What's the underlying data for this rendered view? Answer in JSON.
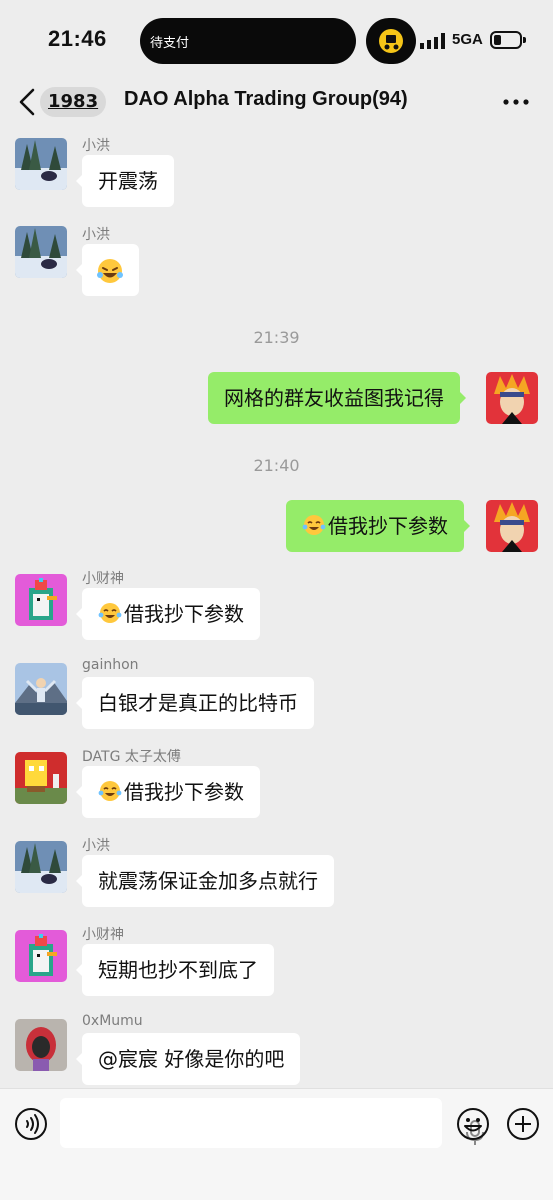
{
  "status_bar": {
    "time": "21:46",
    "island_text": "待支付",
    "network": "5GA",
    "battery_level": 0.3
  },
  "nav": {
    "unread_count": "1983",
    "title": "DAO Alpha Trading Group(94)"
  },
  "messages": [
    {
      "sender": "小洪",
      "text": "开震荡",
      "avatar": "snow-forest-avatar"
    },
    {
      "sender": "小洪",
      "text": "",
      "emoji": "laughing-emoji",
      "avatar": "snow-forest-avatar"
    },
    {
      "time": "21:39"
    },
    {
      "self": true,
      "text": "网格的群友收益图我记得",
      "avatar": "naruto-avatar"
    },
    {
      "time": "21:40"
    },
    {
      "self": true,
      "text": "借我抄下参数",
      "emoji": "tears-of-joy-emoji",
      "avatar": "naruto-avatar"
    },
    {
      "sender": "小财神",
      "text": "借我抄下参数",
      "emoji": "tears-of-joy-emoji",
      "avatar": "pixel-penguin-avatar"
    },
    {
      "sender": "gainhon",
      "text": "白银才是真正的比特币",
      "avatar": "mountain-person-avatar"
    },
    {
      "sender": "DATG 太子太傅",
      "text": "借我抄下参数",
      "emoji": "tears-of-joy-emoji",
      "avatar": "sponge-figure-avatar"
    },
    {
      "sender": "小洪",
      "text": "就震荡保证金加多点就行",
      "avatar": "snow-forest-avatar"
    },
    {
      "sender": "小财神",
      "text": "短期也抄不到底了",
      "avatar": "pixel-penguin-avatar"
    },
    {
      "sender": "0xMumu",
      "text": "@宸宸 好像是你的吧",
      "avatar": "hooded-figure-avatar"
    }
  ],
  "colors": {
    "background": "#ededed",
    "outgoing_bubble": "#95ec69",
    "incoming_bubble": "#ffffff"
  },
  "icons": [
    "back-chevron-icon",
    "more-dots-icon",
    "voice-input-icon",
    "microphone-icon",
    "emoji-smile-icon",
    "add-plus-icon"
  ]
}
